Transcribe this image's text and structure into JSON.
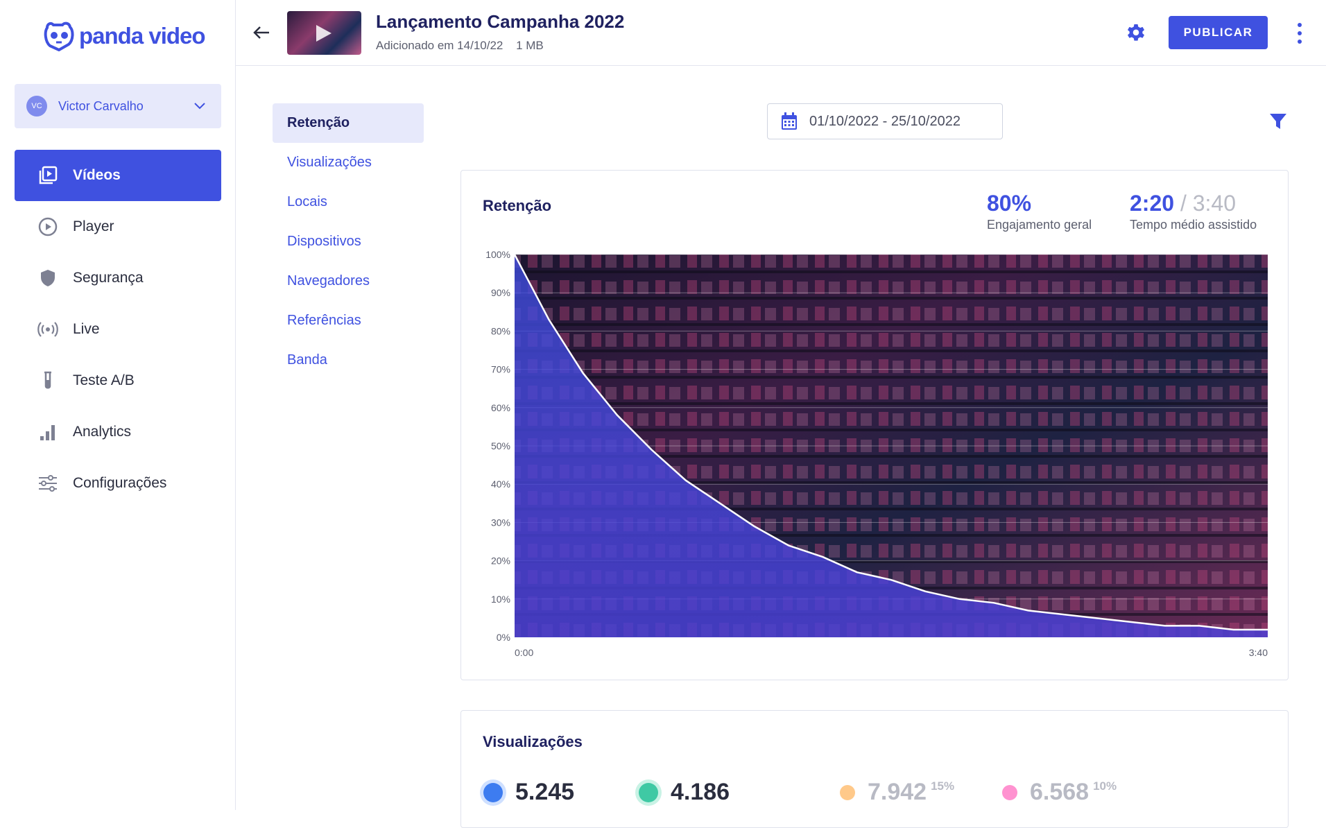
{
  "brand": {
    "name": "panda video",
    "accent": "#3f51e0"
  },
  "account": {
    "initials": "VC",
    "name": "Victor Carvalho"
  },
  "sidebar": {
    "items": [
      {
        "label": "Vídeos",
        "icon": "video-library-icon",
        "active": true
      },
      {
        "label": "Player",
        "icon": "play-circle-icon"
      },
      {
        "label": "Segurança",
        "icon": "shield-icon"
      },
      {
        "label": "Live",
        "icon": "broadcast-icon"
      },
      {
        "label": "Teste A/B",
        "icon": "test-tube-icon"
      },
      {
        "label": "Analytics",
        "icon": "bar-chart-icon"
      },
      {
        "label": "Configurações",
        "icon": "sliders-icon"
      }
    ]
  },
  "header": {
    "title": "Lançamento Campanha 2022",
    "added": "Adicionado em 14/10/22",
    "size": "1 MB",
    "publish_label": "PUBLICAR"
  },
  "subnav": {
    "items": [
      "Retenção",
      "Visualizações",
      "Locais",
      "Dispositivos",
      "Navegadores",
      "Referências",
      "Banda"
    ],
    "active": 0
  },
  "daterange": {
    "value": "01/10/2022 - 25/10/2022"
  },
  "retention": {
    "title": "Retenção",
    "engagement_value": "80%",
    "engagement_label": "Engajamento geral",
    "avg_time": "2:20",
    "total_time": "/ 3:40",
    "avg_time_label": "Tempo médio assistido"
  },
  "chart_data": {
    "type": "area",
    "x": [
      "0:00",
      "3:40"
    ],
    "xlabels": [
      "0:00",
      "3:40"
    ],
    "ytick_labels": [
      "100%",
      "90%",
      "80%",
      "70%",
      "60%",
      "50%",
      "40%",
      "30%",
      "20%",
      "10%",
      "0%"
    ],
    "ylim": [
      0,
      100
    ],
    "grid": true,
    "series": [
      {
        "x_seconds": [
          0,
          10,
          20,
          30,
          40,
          50,
          60,
          70,
          80,
          90,
          100,
          110,
          120,
          130,
          140,
          150,
          160,
          170,
          180,
          190,
          200,
          210,
          220
        ],
        "values": [
          100,
          83,
          69,
          58,
          49,
          41,
          35,
          29,
          24,
          21,
          17,
          15,
          12,
          10,
          9,
          7,
          6,
          5,
          4,
          3,
          3,
          2,
          2
        ]
      }
    ]
  },
  "views": {
    "title": "Visualizações",
    "stats": [
      {
        "value": "5.245",
        "color": "#3d7cf0",
        "pct": ""
      },
      {
        "value": "4.186",
        "color": "#3fc9a4",
        "pct": ""
      },
      {
        "value": "7.942",
        "color": "#ffc98a",
        "pct": "15%"
      },
      {
        "value": "6.568",
        "color": "#ff92d0",
        "pct": "10%"
      }
    ]
  }
}
